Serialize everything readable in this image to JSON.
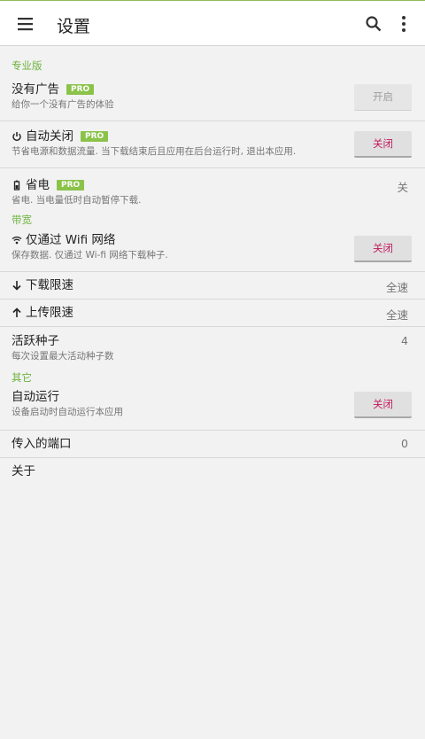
{
  "appbar": {
    "title": "设置"
  },
  "sections": {
    "pro": "专业版",
    "bandwidth": "带宽",
    "other": "其它"
  },
  "no_ads": {
    "title": "没有广告",
    "badge": "PRO",
    "subtitle": "给你一个没有广告的体验",
    "button": "开启"
  },
  "auto_shutdown": {
    "title": "自动关闭",
    "badge": "PRO",
    "subtitle": "节省电源和数据流量. 当下载结束后且应用在后台运行时, 退出本应用.",
    "button": "关闭"
  },
  "battery_save": {
    "title": "省电",
    "badge": "PRO",
    "subtitle": "省电. 当电量低时自动暂停下载.",
    "value": "关"
  },
  "wifi_only": {
    "title": "仅通过 Wifi 网络",
    "subtitle": "保存数据. 仅通过 Wi-fi 网络下载种子.",
    "button": "关闭"
  },
  "download_limit": {
    "title": "下载限速",
    "value": "全速"
  },
  "upload_limit": {
    "title": "上传限速",
    "value": "全速"
  },
  "active_torrents": {
    "title": "活跃种子",
    "subtitle": "每次设置最大活动种子数",
    "value": "4"
  },
  "autostart": {
    "title": "自动运行",
    "subtitle": "设备启动时自动运行本应用",
    "button": "关闭"
  },
  "incoming_port": {
    "title": "传入的端口",
    "value": "0"
  },
  "about": {
    "title": "关于"
  },
  "colors": {
    "accent": "#6db33f",
    "pro_badge": "#8bc34a",
    "button_text": "#c2185b"
  },
  "icons": [
    "menu-icon",
    "search-icon",
    "more-vert-icon",
    "power-icon",
    "battery-icon",
    "wifi-icon",
    "arrow-down-icon",
    "arrow-up-icon"
  ]
}
